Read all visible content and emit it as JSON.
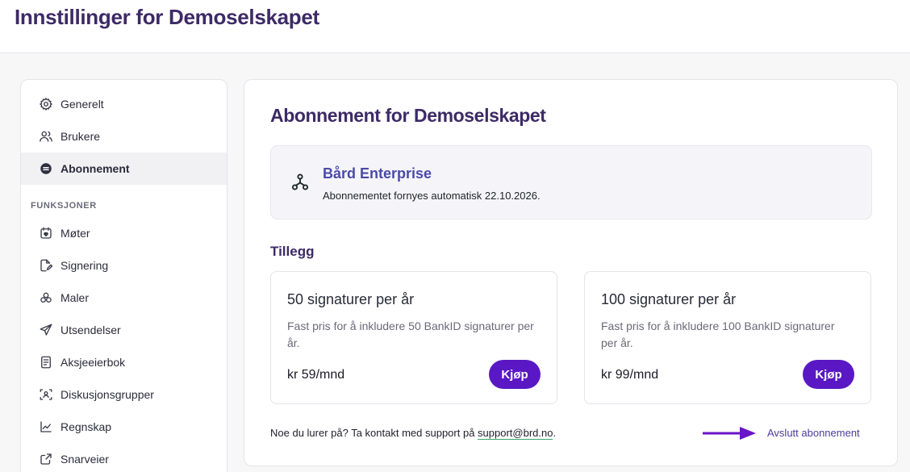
{
  "header": {
    "title": "Innstillinger for Demoselskapet"
  },
  "sidebar": {
    "items": [
      {
        "label": "Generelt",
        "icon": "gear-icon"
      },
      {
        "label": "Brukere",
        "icon": "users-icon"
      },
      {
        "label": "Abonnement",
        "icon": "subscription-icon",
        "active": true
      }
    ],
    "section_label": "FUNKSJONER",
    "feature_items": [
      {
        "label": "Møter",
        "icon": "calendar-icon"
      },
      {
        "label": "Signering",
        "icon": "signature-icon"
      },
      {
        "label": "Maler",
        "icon": "templates-icon"
      },
      {
        "label": "Utsendelser",
        "icon": "send-icon"
      },
      {
        "label": "Aksjeeierbok",
        "icon": "book-icon"
      },
      {
        "label": "Diskusjonsgrupper",
        "icon": "group-icon"
      },
      {
        "label": "Regnskap",
        "icon": "chart-icon"
      },
      {
        "label": "Snarveier",
        "icon": "shortcut-icon"
      }
    ]
  },
  "main": {
    "title": "Abonnement for Demoselskapet",
    "plan": {
      "name": "Bård Enterprise",
      "renewal": "Abonnementet fornyes automatisk 22.10.2026.",
      "icon": "hierarchy-icon"
    },
    "addons_title": "Tillegg",
    "addons": [
      {
        "title": "50 signaturer per år",
        "description": "Fast pris for å inkludere 50 BankID signaturer per år.",
        "price": "kr 59/mnd",
        "button": "Kjøp"
      },
      {
        "title": "100 signaturer per år",
        "description": "Fast pris for å inkludere 100 BankID signaturer per år.",
        "price": "kr 99/mnd",
        "button": "Kjøp"
      }
    ],
    "footer": {
      "text": "Noe du lurer på? Ta kontakt med support på ",
      "email": "support@brd.no",
      "end": ".",
      "cancel": "Avslutt abonnement"
    }
  },
  "colors": {
    "accent": "#5a18c4",
    "title": "#3d2a66",
    "plan_name": "#4b4aa8",
    "arrow": "#6a14c8"
  }
}
